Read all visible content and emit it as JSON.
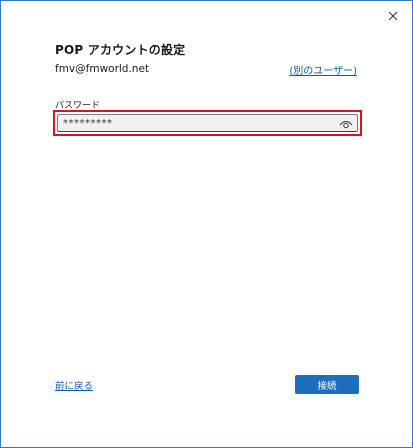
{
  "dialog": {
    "title": "POP アカウントの設定",
    "email": "fmv@fmworld.net",
    "other_user_link": "(別のユーザー)",
    "password": {
      "label": "パスワード",
      "value": "*********"
    },
    "back_link": "前に戻る",
    "connect_button": "接続"
  },
  "colors": {
    "accent": "#1d6ebf",
    "link": "#0b5cad",
    "highlight": "#d8151d"
  },
  "icons": {
    "close": "close-icon",
    "reveal_password": "eye-icon"
  }
}
